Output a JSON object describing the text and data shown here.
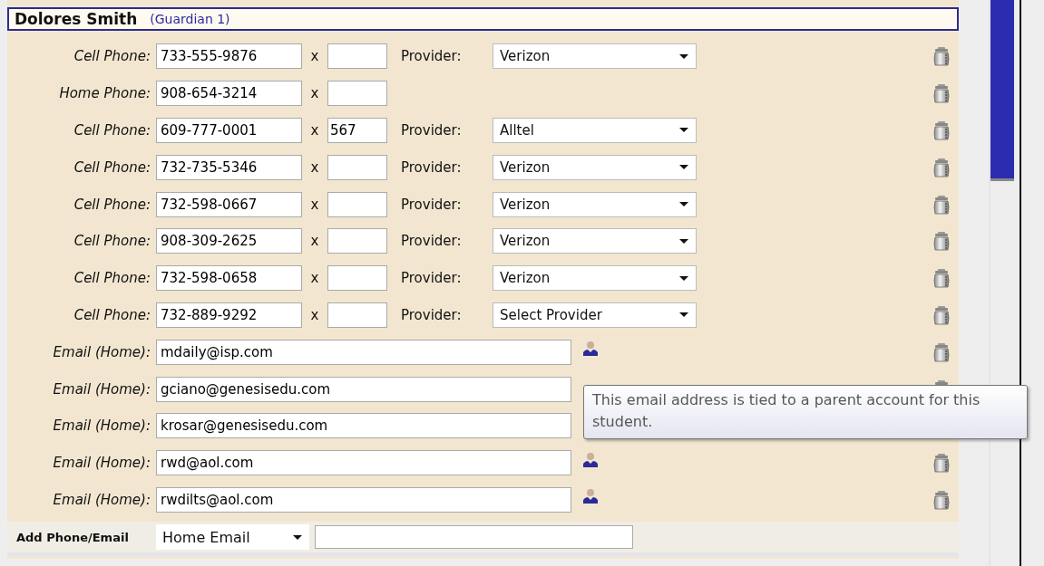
{
  "header": {
    "name": "Dolores Smith",
    "role": "(Guardian 1)"
  },
  "contacts": [
    {
      "kind": "phone",
      "label": "Cell Phone:",
      "number": "733-555-9876",
      "ext_mark": "x",
      "provider_label": "Provider:",
      "provider": "Verizon"
    },
    {
      "kind": "phone",
      "label": "Home Phone:",
      "number": "908-654-3214",
      "ext_mark": "x"
    },
    {
      "kind": "phone",
      "label": "Cell Phone:",
      "number": "609-777-0001",
      "ext_mark": "x",
      "ext": "567",
      "provider_label": "Provider:",
      "provider": "Alltel"
    },
    {
      "kind": "phone",
      "label": "Cell Phone:",
      "number": "732-735-5346",
      "ext_mark": "x",
      "provider_label": "Provider:",
      "provider": "Verizon"
    },
    {
      "kind": "phone",
      "label": "Cell Phone:",
      "number": "732-598-0667",
      "ext_mark": "x",
      "provider_label": "Provider:",
      "provider": "Verizon"
    },
    {
      "kind": "phone",
      "label": "Cell Phone:",
      "number": "908-309-2625",
      "ext_mark": "x",
      "provider_label": "Provider:",
      "provider": "Verizon"
    },
    {
      "kind": "phone",
      "label": "Cell Phone:",
      "number": "732-598-0658",
      "ext_mark": "x",
      "provider_label": "Provider:",
      "provider": "Verizon"
    },
    {
      "kind": "phone",
      "label": "Cell Phone:",
      "number": "732-889-9292",
      "ext_mark": "x",
      "provider_label": "Provider:",
      "provider": "Select Provider"
    },
    {
      "kind": "email",
      "label": "Email (Home):",
      "address": "mdaily@isp.com",
      "linked": true
    },
    {
      "kind": "email",
      "label": "Email (Home):",
      "address": "gciano@genesisedu.com"
    },
    {
      "kind": "email",
      "label": "Email (Home):",
      "address": "krosar@genesisedu.com"
    },
    {
      "kind": "email",
      "label": "Email (Home):",
      "address": "rwd@aol.com",
      "linked": true
    },
    {
      "kind": "email",
      "label": "Email (Home):",
      "address": "rwdilts@aol.com",
      "linked": true
    }
  ],
  "add": {
    "label": "Add Phone/Email",
    "type": "Home Email"
  },
  "tooltip": "This email address is tied to a parent account for this student."
}
